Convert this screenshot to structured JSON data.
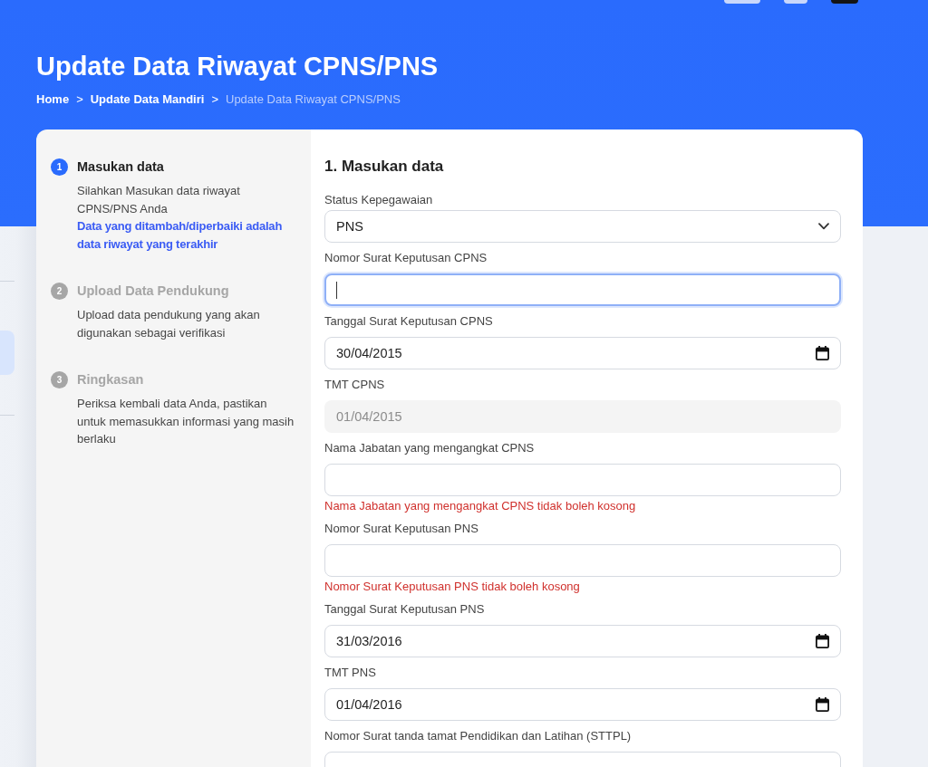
{
  "header": {
    "title": "Update Data Riwayat CPNS/PNS",
    "breadcrumb": [
      {
        "label": "Home",
        "current": false,
        "separator": ">"
      },
      {
        "label": "Update Data Mandiri",
        "current": false,
        "separator": ">"
      },
      {
        "label": "Update Data Riwayat CPNS/PNS",
        "current": true
      }
    ]
  },
  "steps": [
    {
      "number": "1",
      "title": "Masukan data",
      "selected": true,
      "description": "Silahkan Masukan data riwayat CPNS/PNS Anda",
      "note": "Data yang ditambah/diperbaiki adalah data riwayat yang terakhir"
    },
    {
      "number": "2",
      "title": "Upload Data Pendukung",
      "selected": false,
      "description": "Upload data pendukung yang akan digunakan sebagai verifikasi"
    },
    {
      "number": "3",
      "title": "Ringkasan",
      "selected": false,
      "description": "Periksa kembali data Anda, pastikan untuk memasukkan informasi yang masih berlaku"
    }
  ],
  "form": {
    "title": "1. Masukan data",
    "fields": [
      {
        "kind": "select",
        "label": "Status Kepegawaian",
        "value": "PNS",
        "focused": false,
        "disabled": false
      },
      {
        "kind": "text",
        "label": "Nomor Surat Keputusan CPNS",
        "focused": true,
        "disabled": false
      },
      {
        "kind": "date",
        "label": "Tanggal Surat Keputusan CPNS",
        "value": "30/04/2015",
        "focused": false,
        "disabled": false
      },
      {
        "kind": "date",
        "label": "TMT CPNS",
        "value": "01/04/2015",
        "focused": false,
        "disabled": true
      },
      {
        "kind": "text",
        "label": "Nama Jabatan yang mengangkat CPNS",
        "focused": false,
        "disabled": false,
        "error": "Nama Jabatan yang mengangkat CPNS tidak boleh kosong"
      },
      {
        "kind": "text",
        "label": "Nomor Surat Keputusan PNS",
        "focused": false,
        "disabled": false,
        "error": "Nomor Surat Keputusan PNS tidak boleh kosong"
      },
      {
        "kind": "date",
        "label": "Tanggal Surat Keputusan PNS",
        "value": "31/03/2016",
        "focused": false,
        "disabled": false
      },
      {
        "kind": "date",
        "label": "TMT PNS",
        "value": "01/04/2016",
        "focused": false,
        "disabled": false
      },
      {
        "kind": "text",
        "label": "Nomor Surat tanda tamat Pendidikan dan Latihan (STTPL)",
        "focused": false,
        "disabled": false
      }
    ]
  }
}
